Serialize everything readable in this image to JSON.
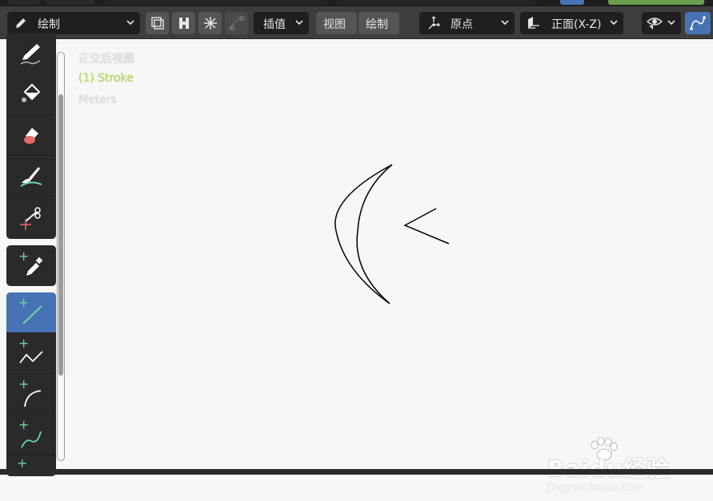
{
  "header": {
    "mode": {
      "label": "绘制",
      "icon": "pencil-icon"
    },
    "interpolate": {
      "label": "插值"
    },
    "menus": {
      "view": "视图",
      "draw": "绘制"
    },
    "pivot": {
      "label": "原点"
    },
    "orientation": {
      "label": "正面(X-Z)"
    }
  },
  "viewport": {
    "view_name": "正交后视图",
    "object_info": "(1) Stroke",
    "units": "Meters"
  },
  "toolbar": {
    "tools": [
      "draw-tool",
      "fill-tool",
      "erase-tool",
      "tint-tool",
      "cutter-tool",
      "eyedropper-tool",
      "line-tool",
      "polyline-tool",
      "arc-tool",
      "curve-tool"
    ],
    "active_tool": "line-tool"
  },
  "watermark": {
    "brand": "Bai",
    "brand_tail": "du",
    "suffix": "经验",
    "url": "jingyan.baidu.com"
  },
  "colors": {
    "header_bg": "#3d3d3d",
    "button_bg": "#1f1f1f",
    "accent": "#4772b3",
    "tool_icon_green": "#6fd6a0",
    "overlay_green": "#bde06e"
  }
}
